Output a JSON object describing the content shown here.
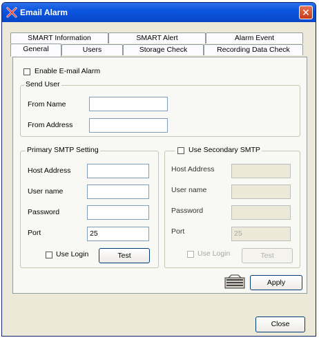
{
  "window": {
    "title": "Email Alarm",
    "close_glyph": "✕"
  },
  "tabs": {
    "row_back": [
      "SMART Information",
      "SMART Alert",
      "Alarm Event"
    ],
    "row_front": [
      "General",
      "Users",
      "Storage Check",
      "Recording Data Check"
    ],
    "active": "General"
  },
  "general": {
    "enable_email_alarm": {
      "label": "Enable E-mail Alarm",
      "checked": false
    }
  },
  "send_user": {
    "title": "Send User",
    "from_name": {
      "label": "From Name",
      "value": ""
    },
    "from_address": {
      "label": "From Address",
      "value": ""
    }
  },
  "primary_smtp": {
    "title": "Primary SMTP Setting",
    "host_address": {
      "label": "Host Address",
      "value": ""
    },
    "user_name": {
      "label": "User name",
      "value": ""
    },
    "password": {
      "label": "Password",
      "value": ""
    },
    "port": {
      "label": "Port",
      "value": "25"
    },
    "use_login": {
      "label": "Use Login",
      "checked": false
    },
    "test_label": "Test"
  },
  "secondary_smtp": {
    "title": "Use Secondary SMTP",
    "checked": false,
    "host_address": {
      "label": "Host Address",
      "value": ""
    },
    "user_name": {
      "label": "User name",
      "value": ""
    },
    "password": {
      "label": "Password",
      "value": ""
    },
    "port": {
      "label": "Port",
      "value": "25"
    },
    "use_login": {
      "label": "Use Login",
      "checked": false
    },
    "test_label": "Test"
  },
  "buttons": {
    "apply": "Apply",
    "close": "Close"
  },
  "colors": {
    "titlebar": "#0b55e0",
    "close_button": "#c63a19",
    "dialog_bg": "#ece9d8",
    "panel_bg": "#f8f8f4"
  },
  "icons": {
    "app": "alarm-icon",
    "apply_side": "keyboard-icon",
    "close": "close-icon"
  }
}
